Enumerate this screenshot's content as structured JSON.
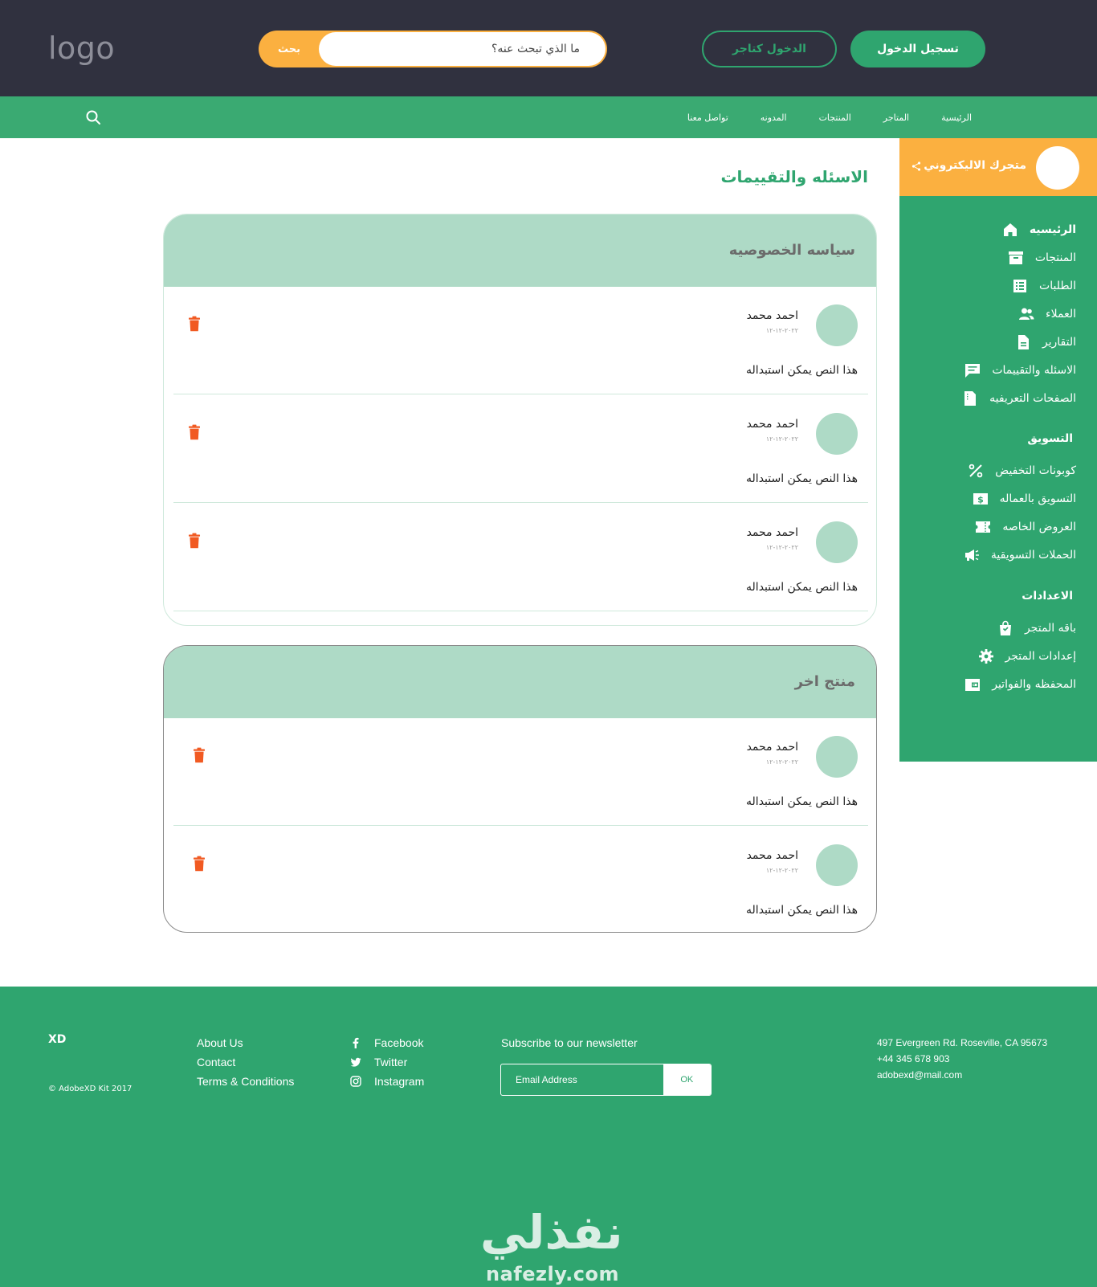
{
  "header": {
    "logo": "logo",
    "search_placeholder": "ما الذي تبحث عنه؟",
    "search_button": "بحث",
    "merchant_login": "الدخول كتاجر",
    "login": "تسجيل الدخول"
  },
  "nav": {
    "items": [
      "الرئيسية",
      "المتاجر",
      "المنتجات",
      "المدونه",
      "تواصل معنا"
    ]
  },
  "sidebar": {
    "store_name": "متجرك الاليكتروني",
    "main_items": [
      {
        "label": "الرئيسيه",
        "icon": "home-icon"
      },
      {
        "label": "المنتجات",
        "icon": "archive-icon"
      },
      {
        "label": "الطلبات",
        "icon": "list-icon"
      },
      {
        "label": "العملاء",
        "icon": "users-icon"
      },
      {
        "label": "التقارير",
        "icon": "document-icon"
      },
      {
        "label": "الاسئله والتقييمات",
        "icon": "chat-icon"
      },
      {
        "label": "الصفحات التعريفيه",
        "icon": "page-icon"
      }
    ],
    "marketing_title": "التسويق",
    "marketing_items": [
      {
        "label": "كوبونات التخفيض",
        "icon": "percent-icon"
      },
      {
        "label": "التسويق بالعماله",
        "icon": "dollar-icon"
      },
      {
        "label": "العروض الخاصه",
        "icon": "ticket-icon"
      },
      {
        "label": "الحملات التسويقية",
        "icon": "megaphone-icon"
      }
    ],
    "settings_title": "الاعدادات",
    "settings_items": [
      {
        "label": "باقه المتجر",
        "icon": "bag-icon"
      },
      {
        "label": "إعدادات المتجر",
        "icon": "gear-icon"
      },
      {
        "label": "المحفظه والفواتير",
        "icon": "wallet-icon"
      }
    ]
  },
  "main": {
    "title": "الاسئله والتقييمات",
    "sections": [
      {
        "title": "سياسه الخصوصيه",
        "reviews": [
          {
            "name": "احمد محمد",
            "date": "٢٠٢٢-١٢-١٢",
            "text": "هذا النص يمكن استبداله"
          },
          {
            "name": "احمد محمد",
            "date": "٢٠٢٢-١٢-١٢",
            "text": "هذا النص يمكن استبداله"
          },
          {
            "name": "احمد محمد",
            "date": "٢٠٢٢-١٢-١٢",
            "text": "هذا النص يمكن استبداله"
          }
        ]
      },
      {
        "title": "منتج اخر",
        "reviews": [
          {
            "name": "احمد محمد",
            "date": "٢٠٢٢-١٢-١٢",
            "text": "هذا النص يمكن استبداله"
          },
          {
            "name": "احمد محمد",
            "date": "٢٠٢٢-١٢-١٢",
            "text": "هذا النص يمكن استبداله"
          }
        ]
      }
    ]
  },
  "footer": {
    "brand": "XD",
    "copyright": "© AdobeXD Kit 2017",
    "links": [
      "About Us",
      "Contact",
      "Terms & Conditions"
    ],
    "social": [
      "Facebook",
      "Twitter",
      "Instagram"
    ],
    "newsletter_title": "Subscribe to our newsletter",
    "email_placeholder": "Email Address",
    "ok_label": "OK",
    "address": "497 Evergreen Rd. Roseville, CA 95673",
    "phone": "+44 345 678 903",
    "email": "adobexd@mail.com",
    "watermark_ar": "نفذلي",
    "watermark_en": "nafezly.com"
  },
  "colors": {
    "header_bg": "#30313f",
    "green": "#2fa56f",
    "orange": "#fbb040",
    "light_green": "#aedac6",
    "trash": "#f15a22"
  }
}
